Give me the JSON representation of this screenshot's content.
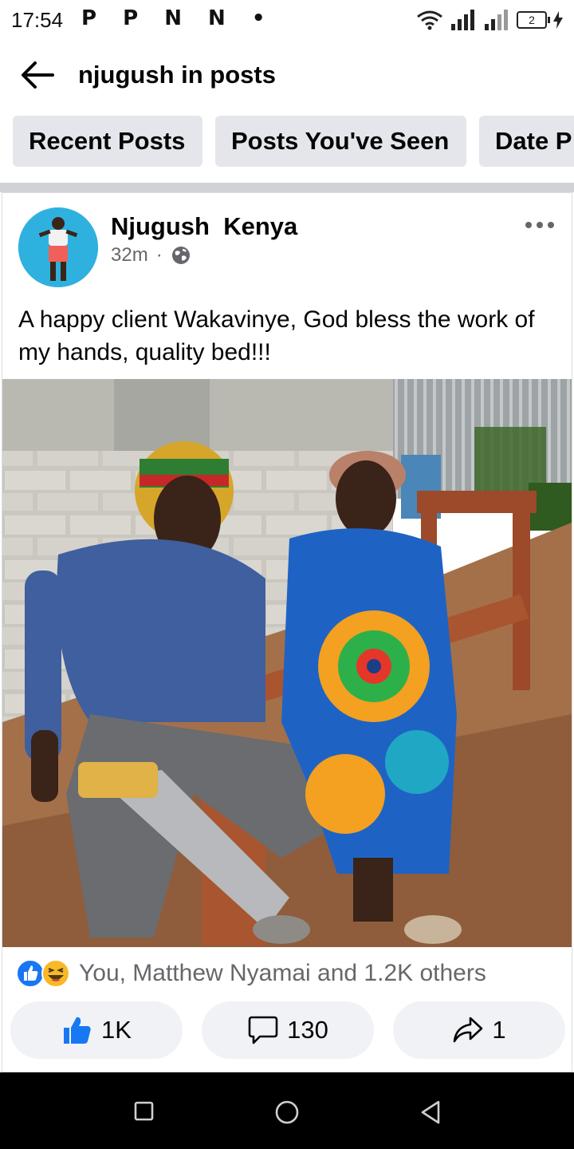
{
  "status_bar": {
    "time": "17:54",
    "notifications": "P P N N •",
    "battery": "2"
  },
  "header": {
    "back_icon": "arrow-left-icon",
    "title": "njugush in posts"
  },
  "filters": [
    {
      "label": "Recent Posts"
    },
    {
      "label": "Posts You've Seen"
    },
    {
      "label": "Date P"
    }
  ],
  "post": {
    "author": "Njugush  Kenya",
    "time": "32m",
    "separator": "·",
    "privacy_icon": "globe-icon",
    "text": "A happy client Wakavinye, God bless the work of my hands, quality bed!!!",
    "reaction_summary": "You, Matthew Nyamai and 1.2K others",
    "actions": {
      "like_count": "1K",
      "comment_count": "130",
      "share_count": "1"
    }
  },
  "colors": {
    "accent": "#1877f2",
    "chip_bg": "#e4e6eb",
    "secondary_text": "#65676b",
    "haha": "#f7b928"
  }
}
